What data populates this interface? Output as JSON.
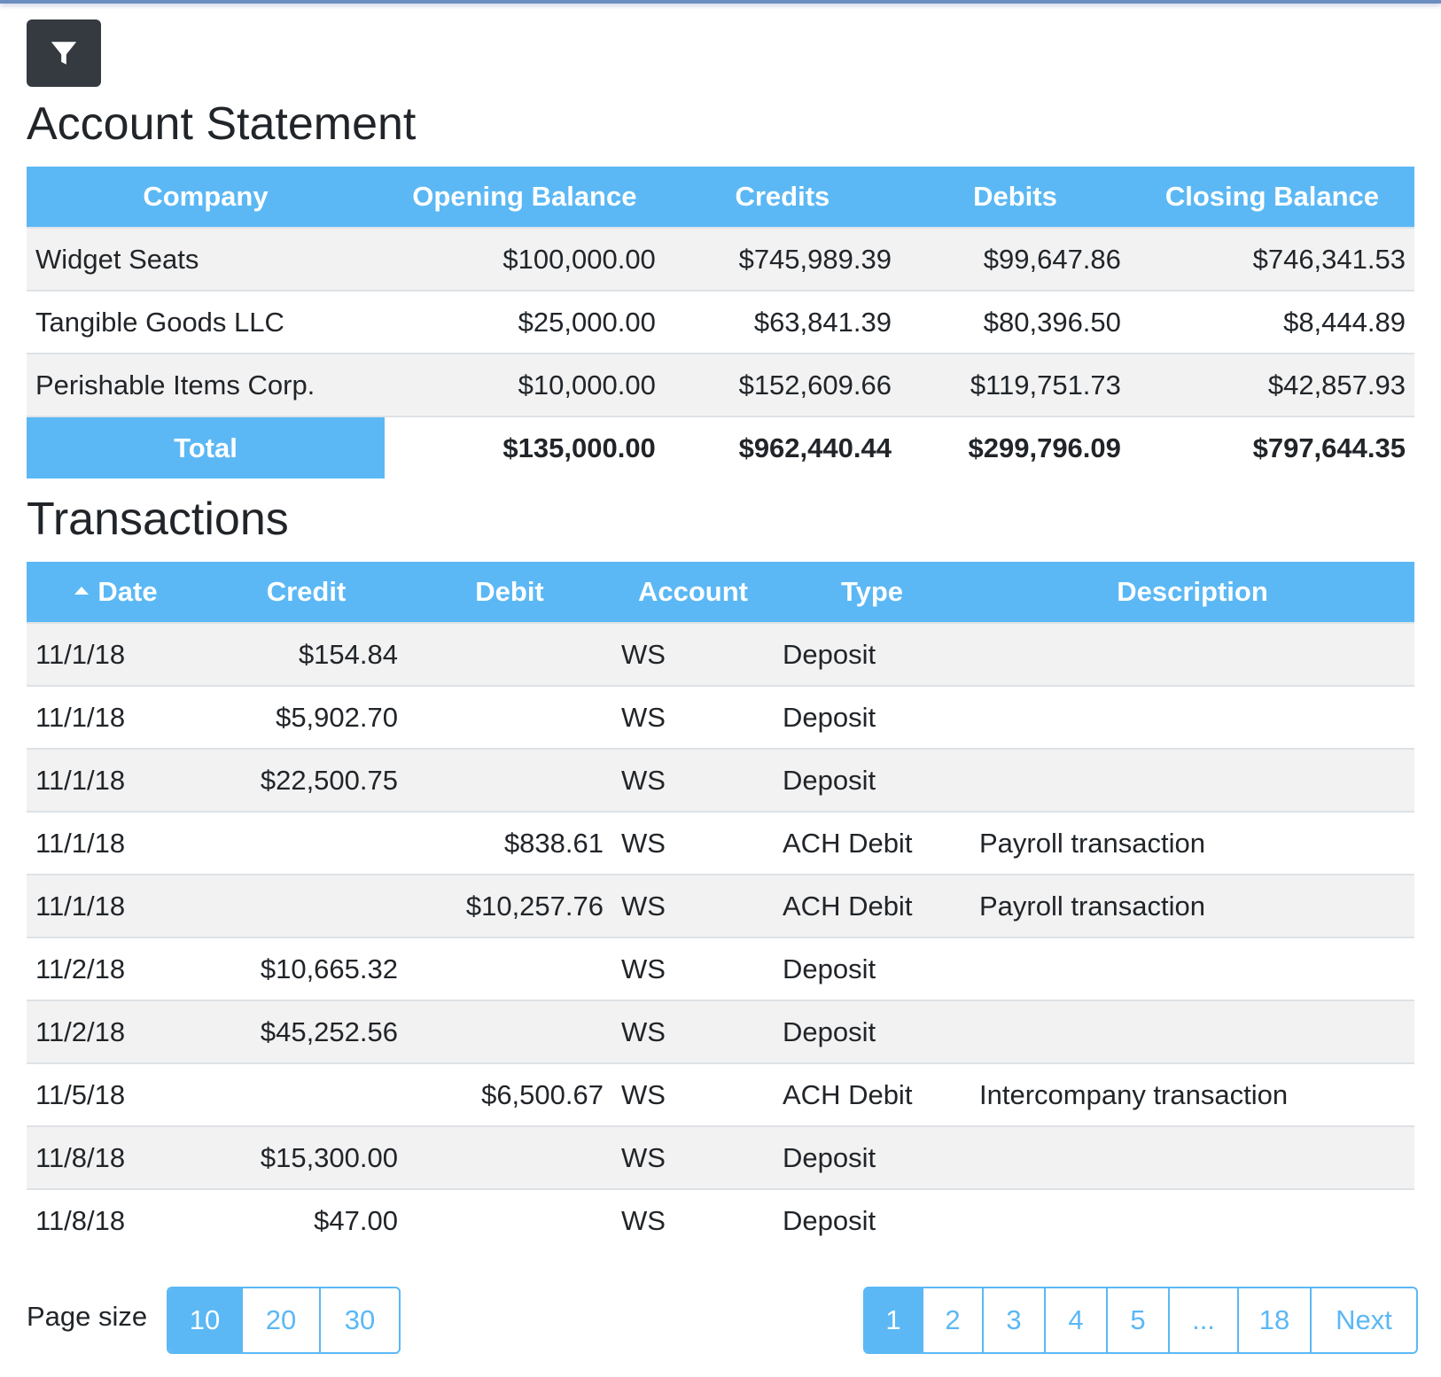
{
  "filter_button": {
    "icon": "filter-icon"
  },
  "statement": {
    "title": "Account Statement",
    "headers": [
      "Company",
      "Opening Balance",
      "Credits",
      "Debits",
      "Closing Balance"
    ],
    "rows": [
      [
        "Widget Seats",
        "$100,000.00",
        "$745,989.39",
        "$99,647.86",
        "$746,341.53"
      ],
      [
        "Tangible Goods LLC",
        "$25,000.00",
        "$63,841.39",
        "$80,396.50",
        "$8,444.89"
      ],
      [
        "Perishable Items Corp.",
        "$10,000.00",
        "$152,609.66",
        "$119,751.73",
        "$42,857.93"
      ]
    ],
    "total": {
      "label": "Total",
      "opening": "$135,000.00",
      "credits": "$962,440.44",
      "debits": "$299,796.09",
      "closing": "$797,644.35"
    }
  },
  "transactions": {
    "title": "Transactions",
    "headers": [
      "Date",
      "Credit",
      "Debit",
      "Account",
      "Type",
      "Description"
    ],
    "sort": {
      "column": "Date",
      "direction": "ascending"
    },
    "rows": [
      [
        "11/1/18",
        "$154.84",
        "",
        "WS",
        "Deposit",
        ""
      ],
      [
        "11/1/18",
        "$5,902.70",
        "",
        "WS",
        "Deposit",
        ""
      ],
      [
        "11/1/18",
        "$22,500.75",
        "",
        "WS",
        "Deposit",
        ""
      ],
      [
        "11/1/18",
        "",
        "$838.61",
        "WS",
        "ACH Debit",
        "Payroll transaction"
      ],
      [
        "11/1/18",
        "",
        "$10,257.76",
        "WS",
        "ACH Debit",
        "Payroll transaction"
      ],
      [
        "11/2/18",
        "$10,665.32",
        "",
        "WS",
        "Deposit",
        ""
      ],
      [
        "11/2/18",
        "$45,252.56",
        "",
        "WS",
        "Deposit",
        ""
      ],
      [
        "11/5/18",
        "",
        "$6,500.67",
        "WS",
        "ACH Debit",
        "Intercompany transaction"
      ],
      [
        "11/8/18",
        "$15,300.00",
        "",
        "WS",
        "Deposit",
        ""
      ],
      [
        "11/8/18",
        "$47.00",
        "",
        "WS",
        "Deposit",
        ""
      ]
    ]
  },
  "page_size": {
    "label": "Page size",
    "options": [
      "10",
      "20",
      "30"
    ],
    "selected": "10"
  },
  "pagination": {
    "pages": [
      "1",
      "2",
      "3",
      "4",
      "5",
      "...",
      "18"
    ],
    "current": "1",
    "next_label": "Next"
  },
  "colors": {
    "header_bg": "#5bb8f5",
    "filter_button_bg": "#343a40",
    "stripe": "#f2f2f2"
  }
}
